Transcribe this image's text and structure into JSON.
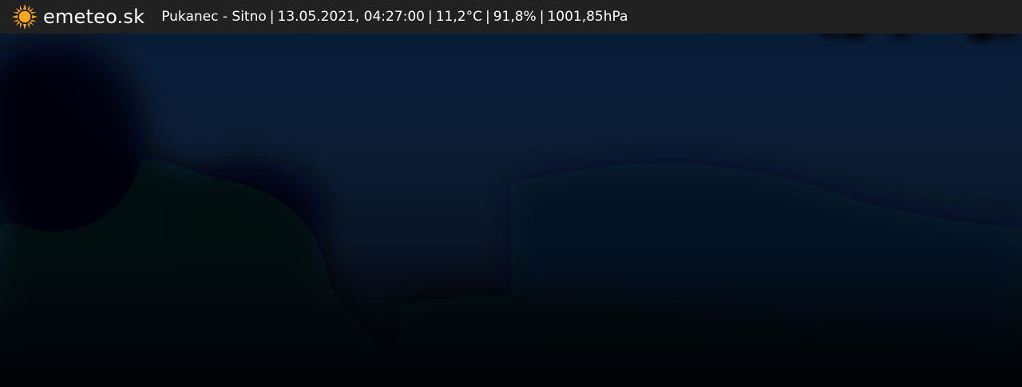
{
  "header": {
    "logo_text": "emeteo.sk",
    "logo_icon": "sun-icon",
    "logo_color": "#f5a623",
    "bar_color": "#212121"
  },
  "weather": {
    "location": "Pukanec - Sitno",
    "datetime": "13.05.2021, 04:27:00",
    "temperature": "11,2°C",
    "humidity": "91,8%",
    "pressure": "1001,85hPa",
    "separator": "|"
  },
  "image": {
    "subject": "webcam-night-sky",
    "sky_color": "#0a1d38"
  }
}
